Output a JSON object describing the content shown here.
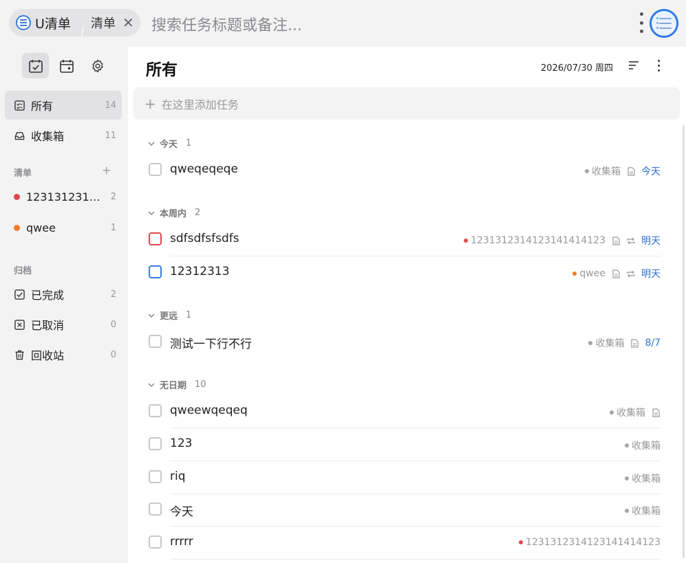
{
  "topbar": {
    "app_tab": "U清单",
    "list_tab": "清单",
    "close_glyph": "✕",
    "search_placeholder": "搜索任务标题或备注..."
  },
  "sidebar": {
    "nav": [
      {
        "label": "所有",
        "count": "14",
        "icon": "checklist-icon",
        "active": true
      },
      {
        "label": "收集箱",
        "count": "11",
        "icon": "inbox-icon"
      }
    ],
    "lists_title": "清单",
    "lists_add": "+",
    "lists": [
      {
        "label": "1231312314…",
        "count": "2",
        "color": "#e0474f"
      },
      {
        "label": "qwee",
        "count": "1",
        "color": "#f07a24"
      }
    ],
    "archive_title": "归档",
    "archive": [
      {
        "label": "已完成",
        "count": "2",
        "icon": "checkbox-checked-icon"
      },
      {
        "label": "已取消",
        "count": "0",
        "icon": "checkbox-cancel-icon"
      },
      {
        "label": "回收站",
        "count": "0",
        "icon": "trash-icon"
      }
    ]
  },
  "main": {
    "title": "所有",
    "date": "2026/07/30 周四",
    "add_placeholder": "在这里添加任务",
    "add_plus": "+",
    "groups": [
      {
        "title": "今天",
        "count": "1"
      },
      {
        "title": "本周内",
        "count": "2"
      },
      {
        "title": "更远",
        "count": "1"
      },
      {
        "title": "无日期",
        "count": "10"
      }
    ],
    "tasks": [
      {
        "title": "qweqeqeqe",
        "list": "收集箱",
        "list_color": "#a4a4ab",
        "note": true,
        "repeat": false,
        "due": "今天",
        "check": "gray"
      },
      {
        "title": "sdfsdfsfsdfs",
        "list": "1231312314123141414123",
        "list_color": "#e0474f",
        "note": true,
        "repeat": true,
        "due": "明天",
        "check": "red"
      },
      {
        "title": "12312313",
        "list": "qwee",
        "list_color": "#f07a24",
        "note": true,
        "repeat": true,
        "due": "明天",
        "check": "blue"
      },
      {
        "title": "测试一下行不行",
        "list": "收集箱",
        "list_color": "#a4a4ab",
        "note": true,
        "repeat": false,
        "due": "8/7",
        "check": "gray"
      },
      {
        "title": "qweewqeqeq",
        "list": "收集箱",
        "list_color": "#a4a4ab",
        "note": true,
        "repeat": false,
        "due": "",
        "check": "gray"
      },
      {
        "title": "123",
        "list": "收集箱",
        "list_color": "#a4a4ab",
        "note": false,
        "repeat": false,
        "due": "",
        "check": "gray"
      },
      {
        "title": "riq",
        "list": "收集箱",
        "list_color": "#a4a4ab",
        "note": false,
        "repeat": false,
        "due": "",
        "check": "gray"
      },
      {
        "title": "今天",
        "list": "收集箱",
        "list_color": "#a4a4ab",
        "note": false,
        "repeat": false,
        "due": "",
        "check": "gray"
      },
      {
        "title": "rrrrr",
        "list": "1231312314123141414123",
        "list_color": "#e0474f",
        "note": false,
        "repeat": false,
        "due": "",
        "check": "gray"
      }
    ]
  },
  "colors": {
    "accent": "#2f7be5",
    "due_text": "#2f6fd6",
    "sidebar_bg": "#f3f3f4",
    "main_bg": "#ffffff"
  }
}
